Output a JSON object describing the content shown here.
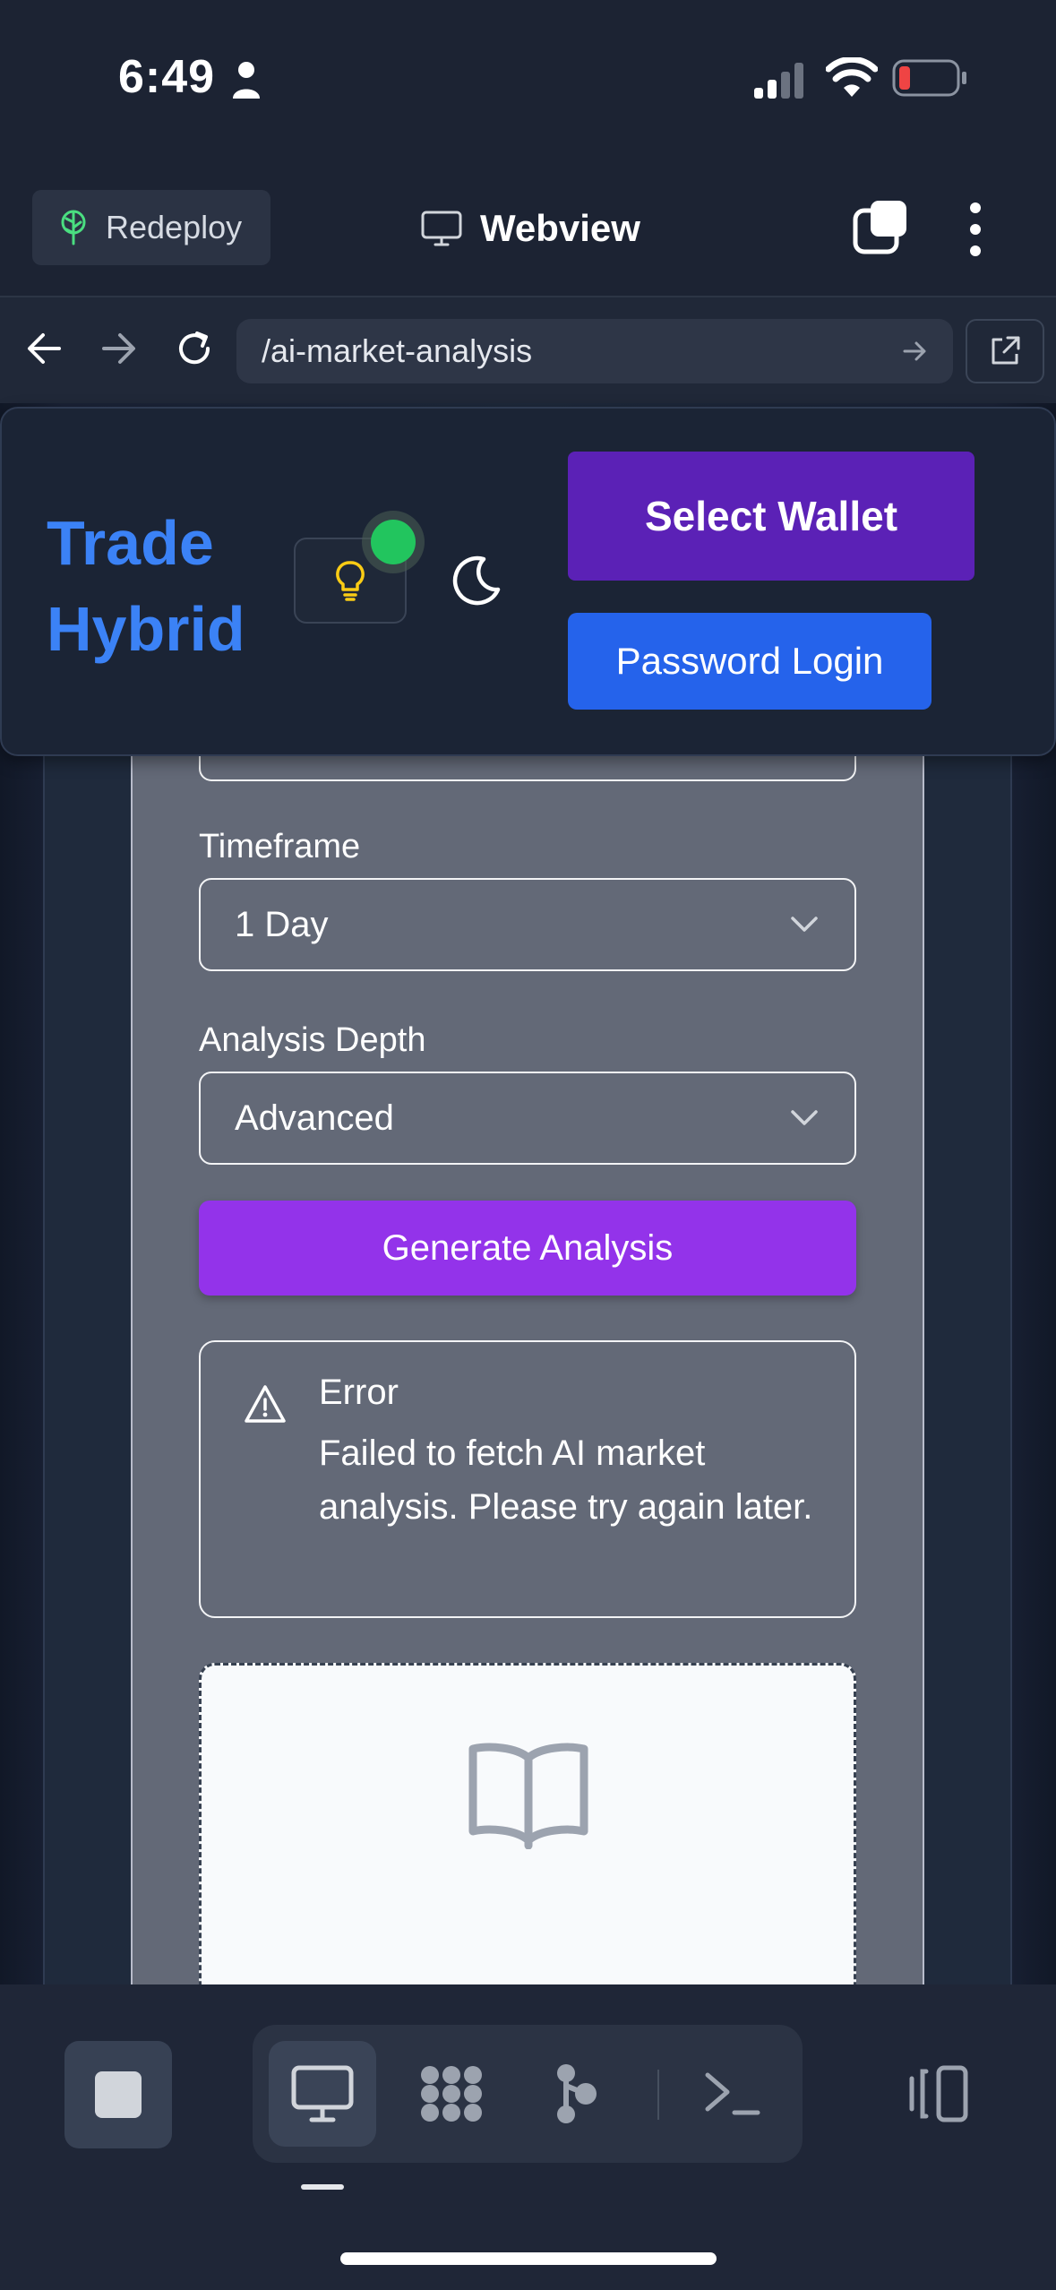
{
  "status_bar": {
    "time": "6:49"
  },
  "app_bar": {
    "redeploy_label": "Redeploy",
    "title": "Webview"
  },
  "url_bar": {
    "path": "/ai-market-analysis"
  },
  "header": {
    "brand_line1": "Trade",
    "brand_line2": "Hybrid",
    "select_wallet_label": "Select Wallet",
    "password_login_label": "Password Login",
    "brand_color": "#3b82f6"
  },
  "form": {
    "timeframe_label": "Timeframe",
    "timeframe_value": "1 Day",
    "depth_label": "Analysis Depth",
    "depth_value": "Advanced",
    "generate_label": "Generate Analysis"
  },
  "error": {
    "title": "Error",
    "message": "Failed to fetch AI market analysis. Please try again later."
  },
  "toolbar": {
    "icons": [
      "stop-icon",
      "monitor-icon",
      "apps-grid-icon",
      "git-branch-icon",
      "terminal-icon",
      "split-view-icon"
    ]
  }
}
